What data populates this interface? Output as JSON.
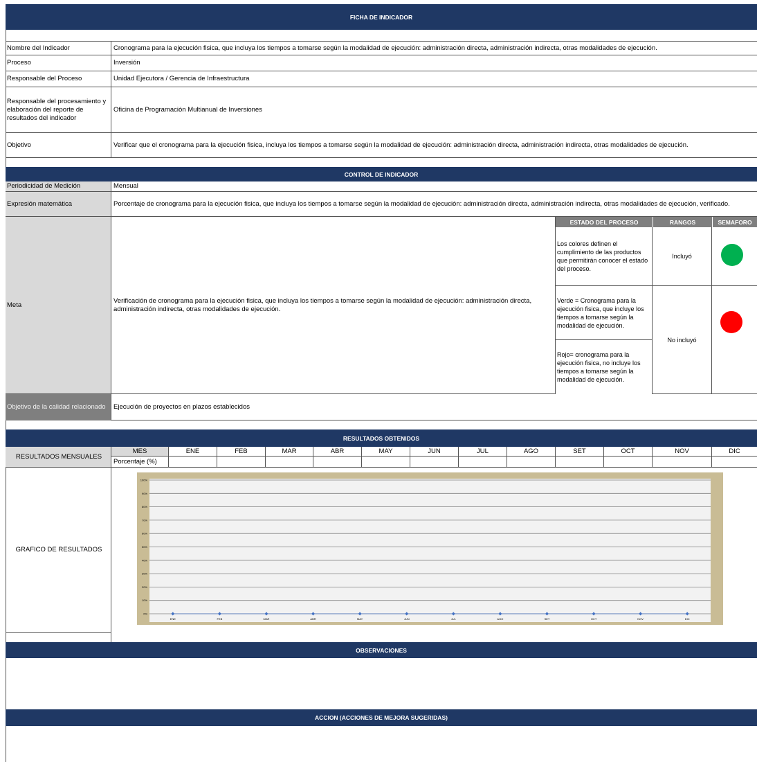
{
  "ficha": {
    "header": "FICHA DE INDICADOR",
    "rows": {
      "nombre_label": "Nombre del Indicador",
      "nombre_value": "Cronograma para la ejecución fisica, que incluya los tiempos a tomarse según la modalidad de ejecución:  administración directa, administración indirecta, otras modalidades de ejecución.",
      "proceso_label": "Proceso",
      "proceso_value": "Inversión",
      "responsable_label": "Responsable del Proceso",
      "responsable_value": "Unidad Ejecutora / Gerencia de Infraestructura",
      "resp_proc_label": "Responsable del procesamiento y elaboración del reporte de resultados del indicador",
      "resp_proc_value": "Oficina de Programación Multianual de Inversiones",
      "objetivo_label": "Objetivo",
      "objetivo_value": "Verificar que el cronograma para la ejecución fisica,  incluya los tiempos a tomarse según la modalidad de ejecución:  administración directa, administración indirecta, otras modalidades de ejecución."
    }
  },
  "control": {
    "header": "CONTROL DE INDICADOR",
    "periodicidad_label": "Periodicidad de Medición",
    "periodicidad_value": "Mensual",
    "expresion_label": "Expresión matemática",
    "expresion_value": "Porcentaje de cronograma para la ejecución fisica, que incluya los tiempos a tomarse según la modalidad de ejecución:  administración directa, administración indirecta, otras modalidades de ejecución, verificado.",
    "meta_label": "Meta",
    "meta_value": "Verificación  de cronograma para la ejecución fisica, que incluya los tiempos a tomarse según la modalidad de ejecución:  administración directa, administración indirecta, otras modalidades de ejecución.",
    "estado_header": "ESTADO DEL PROCESO",
    "rangos_header": "RANGOS",
    "semaforo_header": "SEMAFORO",
    "estado_1": "Los colores definen el cumplimiento de las productos que permitirán conocer el estado del proceso.",
    "estado_2": "Verde = Cronograma para la ejecución fisica, que incluye los tiempos a tomarse según la modalidad de ejecución.",
    "estado_3": "Rojo= cronograma para la ejecución fisica, no incluye los tiempos a tomarse según la modalidad de ejecución.",
    "rango_1": "Incluyó",
    "rango_2": "No incluyó",
    "semaforo_green": "#00b050",
    "semaforo_red": "#ff0000",
    "calidad_label": "Objetivo de la calidad relacionado",
    "calidad_value": "Ejecución de proyectos en plazos establecidos"
  },
  "resultados": {
    "header": "RESULTADOS OBTENIDOS",
    "mensuales_label": "RESULTADOS MENSUALES",
    "mes_label": "MES",
    "porcentaje_label": "Porcentaje (%)",
    "months": [
      "ENE",
      "FEB",
      "MAR",
      "ABR",
      "MAY",
      "JUN",
      "JUL",
      "AGO",
      "SET",
      "OCT",
      "NOV",
      "DIC"
    ],
    "grafico_label": "GRAFICO DE RESULTADOS"
  },
  "chart_data": {
    "type": "line",
    "categories": [
      "ENE",
      "FEB",
      "MAR",
      "ABR",
      "MAY",
      "JUN",
      "JUL",
      "AGO",
      "SET",
      "OCT",
      "NOV",
      "DIC"
    ],
    "series": [
      {
        "values": [
          0,
          0,
          0,
          0,
          0,
          0,
          0,
          0,
          0,
          0,
          0,
          0
        ]
      }
    ],
    "y_ticks": [
      "0%",
      "10%",
      "20%",
      "30%",
      "40%",
      "50%",
      "60%",
      "70%",
      "80%",
      "90%",
      "100%"
    ],
    "ylim": [
      0,
      100
    ],
    "grid": true,
    "marker_color": "#4472c4"
  },
  "observaciones": {
    "header": "OBSERVACIONES"
  },
  "accion": {
    "header": "ACCION (ACCIONES DE MEJORA SUGERIDAS)"
  }
}
